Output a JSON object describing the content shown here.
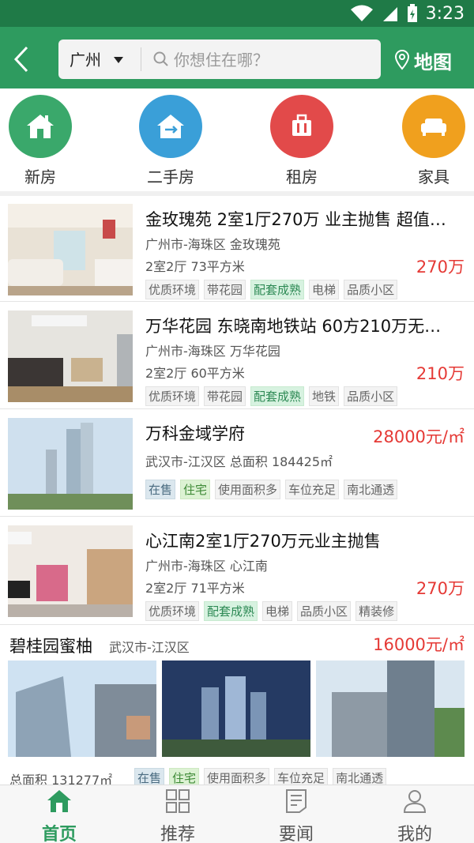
{
  "status": {
    "time": "3:23"
  },
  "header": {
    "city": "广州",
    "search_placeholder": "你想住在哪？",
    "map_label": "地图"
  },
  "categories": [
    {
      "label": "新房",
      "color": "#3aa86b",
      "icon": "house-icon"
    },
    {
      "label": "二手房",
      "color": "#3a9fd8",
      "icon": "house-exchange-icon"
    },
    {
      "label": "租房",
      "color": "#e24a4a",
      "icon": "luggage-icon"
    },
    {
      "label": "家具",
      "color": "#f0a01e",
      "icon": "sofa-icon"
    }
  ],
  "listings": [
    {
      "title": "金玫瑰苑 2室1厅270万 业主抛售 超值…",
      "location": "广州市-海珠区  金玫瑰苑",
      "specs": "2室2厅 73平方米",
      "price": "270万",
      "tags": [
        "优质环境",
        "带花园",
        "配套成熟",
        "电梯",
        "品质小区"
      ]
    },
    {
      "title": "万华花园 东晓南地铁站 60方210万无…",
      "location": "广州市-海珠区  万华花园",
      "specs": "2室2厅 60平方米",
      "price": "210万",
      "tags": [
        "优质环境",
        "带花园",
        "配套成熟",
        "地铁",
        "品质小区"
      ]
    },
    {
      "title": "万科金域学府",
      "location": "武汉市-江汉区  总面积 184425㎡",
      "specs": "",
      "price": "28000元/㎡",
      "tags": [
        "在售",
        "住宅",
        "使用面积多",
        "车位充足",
        "南北通透"
      ]
    },
    {
      "title": "心江南2室1厅270万元业主抛售",
      "location": "广州市-海珠区  心江南",
      "specs": "2室2厅 71平方米",
      "price": "270万",
      "tags": [
        "优质环境",
        "配套成熟",
        "电梯",
        "品质小区",
        "精装修"
      ]
    }
  ],
  "featured": {
    "title": "碧桂园蜜柚",
    "location": "武汉市-江汉区",
    "price": "16000元/㎡",
    "area": "总面积 131277㎡",
    "tags": [
      "在售",
      "住宅",
      "使用面积多",
      "车位充足",
      "南北通透"
    ]
  },
  "tabs": [
    {
      "label": "首页",
      "active": true
    },
    {
      "label": "推荐",
      "active": false
    },
    {
      "label": "要闻",
      "active": false
    },
    {
      "label": "我的",
      "active": false
    }
  ],
  "colors": {
    "primary": "#2e9b5f",
    "price": "#e53935"
  }
}
